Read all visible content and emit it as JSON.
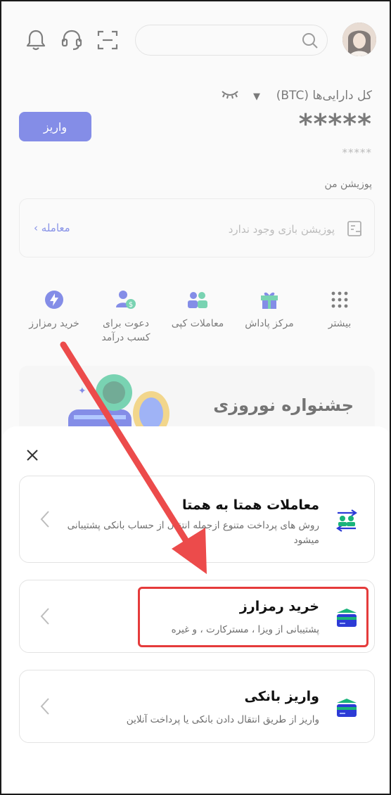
{
  "header": {
    "search": {
      "placeholder": ""
    }
  },
  "assets": {
    "label": "کل دارایی‌ها (BTC)",
    "balance_masked": "*****",
    "balance_sub_masked": "*****",
    "deposit_label": "واریز"
  },
  "positions": {
    "title": "پوزیشن من",
    "empty_text": "پوزیشن بازی وجود ندارد",
    "trade_link": "معامله"
  },
  "shortcuts": [
    {
      "label": "خرید رمزارز",
      "icon": "bolt-icon"
    },
    {
      "label": "دعوت برای کسب درآمد",
      "icon": "invite-icon"
    },
    {
      "label": "معاملات کپی",
      "icon": "copy-trade-icon"
    },
    {
      "label": "مرکز پاداش",
      "icon": "gift-icon"
    },
    {
      "label": "بیشتر",
      "icon": "grid-icon"
    }
  ],
  "banner": {
    "title": "جشنواره نوروزی"
  },
  "sheet": {
    "options": [
      {
        "title": "معاملات همتا به همتا",
        "description": "روش های پرداخت متنوع ازجمله انتقال از حساب بانکی پشتیبانی میشود",
        "icon": "p2p-icon"
      },
      {
        "title": "خرید رمزارز",
        "description": "پشتیبانی از ویزا ، مسترکارت ، و غیره",
        "icon": "card-icon"
      },
      {
        "title": "واریز بانکی",
        "description": "واریز از طریق انتقال دادن بانکی یا پرداخت آنلاین",
        "icon": "bank-card-icon"
      }
    ]
  },
  "colors": {
    "brand_blue": "#2c3bd6",
    "icon_blue": "#3345d6",
    "icon_green": "#19b37a",
    "highlight_red": "#e53b3b"
  }
}
